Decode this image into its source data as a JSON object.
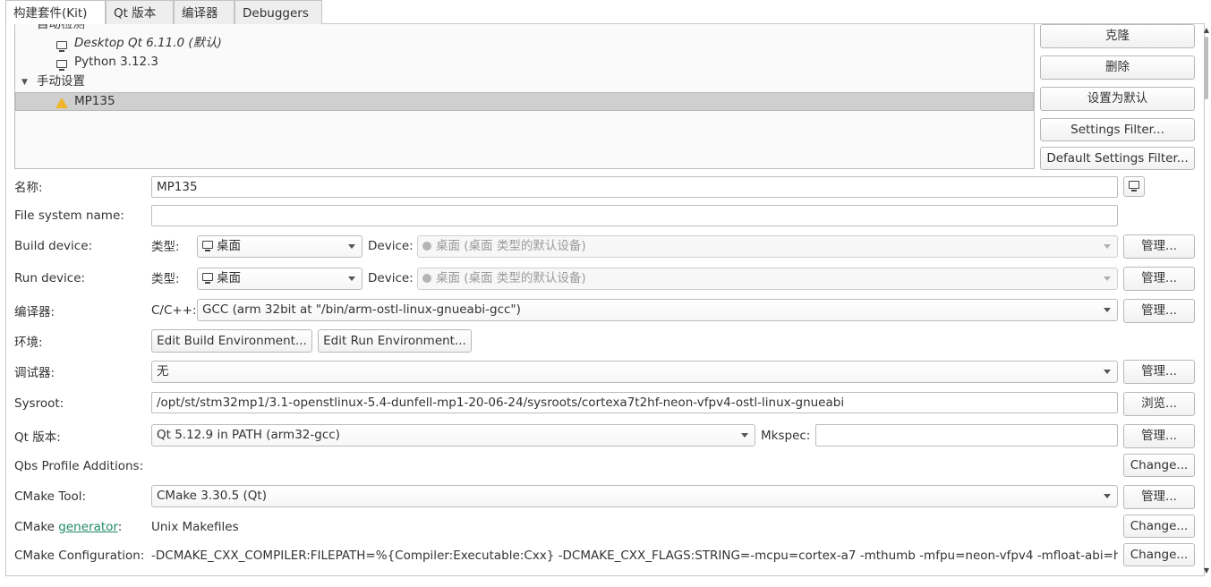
{
  "tabs": [
    "构建套件(Kit)",
    "Qt 版本",
    "编译器",
    "Debuggers"
  ],
  "tree": {
    "partial_header": "自动检测",
    "auto_items": [
      "Desktop Qt 6.11.0 (默认)",
      "Python 3.12.3"
    ],
    "manual_header": "手动设置",
    "manual_items": [
      "MP135"
    ]
  },
  "side_buttons": [
    "克隆",
    "删除",
    "设置为默认",
    "Settings Filter...",
    "Default Settings Filter..."
  ],
  "form": {
    "name_label": "名称:",
    "name_value": "MP135",
    "fs_label": "File system name:",
    "fs_value": "",
    "build_device_label": "Build device:",
    "run_device_label": "Run device:",
    "type_label": "类型:",
    "type_value": "桌面",
    "device_label": "Device:",
    "device_value": "桌面 (桌面 类型的默认设备)",
    "compiler_label": "编译器:",
    "cpp_label": "C/C++:",
    "compiler_value": "GCC (arm 32bit at \"/bin/arm-ostl-linux-gnueabi-gcc\")",
    "env_label": "环境:",
    "edit_build_env": "Edit Build Environment...",
    "edit_run_env": "Edit Run Environment...",
    "debugger_label": "调试器:",
    "debugger_value": "无",
    "sysroot_label": "Sysroot:",
    "sysroot_value": "/opt/st/stm32mp1/3.1-openstlinux-5.4-dunfell-mp1-20-06-24/sysroots/cortexa7t2hf-neon-vfpv4-ostl-linux-gnueabi",
    "qt_label": "Qt 版本:",
    "qt_value": "Qt 5.12.9 in PATH (arm32-gcc)",
    "mkspec_label": "Mkspec:",
    "mkspec_value": "",
    "qbs_label": "Qbs Profile Additions:",
    "cmake_tool_label": "CMake Tool:",
    "cmake_tool_value": "CMake 3.30.5 (Qt)",
    "cmake_gen_prefix": "CMake ",
    "cmake_gen_link": "generator",
    "cmake_gen_suffix": ":",
    "cmake_gen_value": "Unix Makefiles",
    "cmake_config_label": "CMake Configuration:",
    "cmake_config_value": "-DCMAKE_CXX_COMPILER:FILEPATH=%{Compiler:Executable:Cxx} -DCMAKE_CXX_FLAGS:STRING=-mcpu=cortex-a7 -mthumb -mfpu=neon-vfpv4 -mfloat-abi=h..."
  },
  "buttons": {
    "manage": "管理...",
    "browse": "浏览...",
    "change": "Change..."
  },
  "colors": {
    "selection": "#cfcfcf",
    "warning": "#f0b62a",
    "link": "#1f8a62"
  }
}
